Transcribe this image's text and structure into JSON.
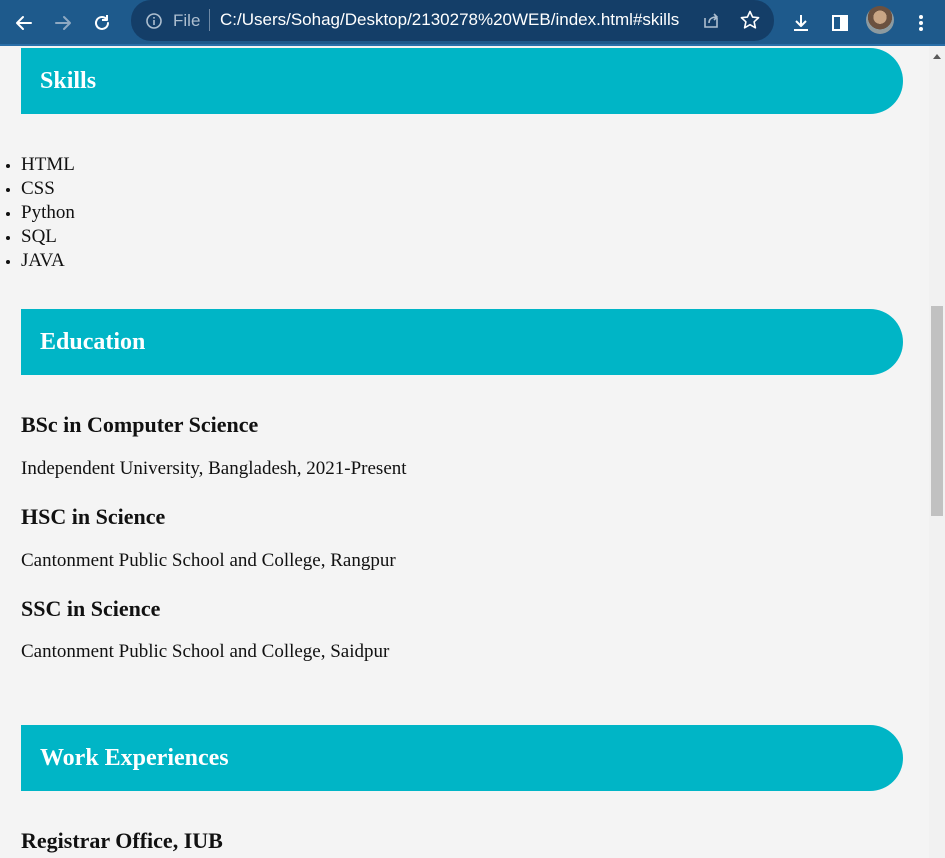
{
  "browser": {
    "file_label": "File",
    "url": "C:/Users/Sohag/Desktop/2130278%20WEB/index.html#skills",
    "icons": [
      "back-arrow-icon",
      "forward-arrow-icon",
      "reload-icon",
      "info-icon",
      "share-icon",
      "star-icon",
      "download-icon",
      "side-panel-icon",
      "avatar",
      "more-vert-icon"
    ]
  },
  "colors": {
    "header_bg": "#00b5c6",
    "page_bg": "#f4f4f4",
    "chrome_bg": "#1e5a8c"
  },
  "skills": {
    "title": "Skills",
    "items": [
      "HTML",
      "CSS",
      "Python",
      "SQL",
      "JAVA"
    ]
  },
  "education": {
    "title": "Education",
    "entries": [
      {
        "degree": "BSc in Computer Science",
        "institute": "Independent University, Bangladesh, 2021-Present"
      },
      {
        "degree": "HSC in Science",
        "institute": "Cantonment Public School and College, Rangpur"
      },
      {
        "degree": "SSC in Science",
        "institute": "Cantonment Public School and College, Saidpur"
      }
    ]
  },
  "work": {
    "title": "Work Experiences",
    "entries": [
      {
        "place": "Registrar Office, IUB"
      }
    ]
  }
}
